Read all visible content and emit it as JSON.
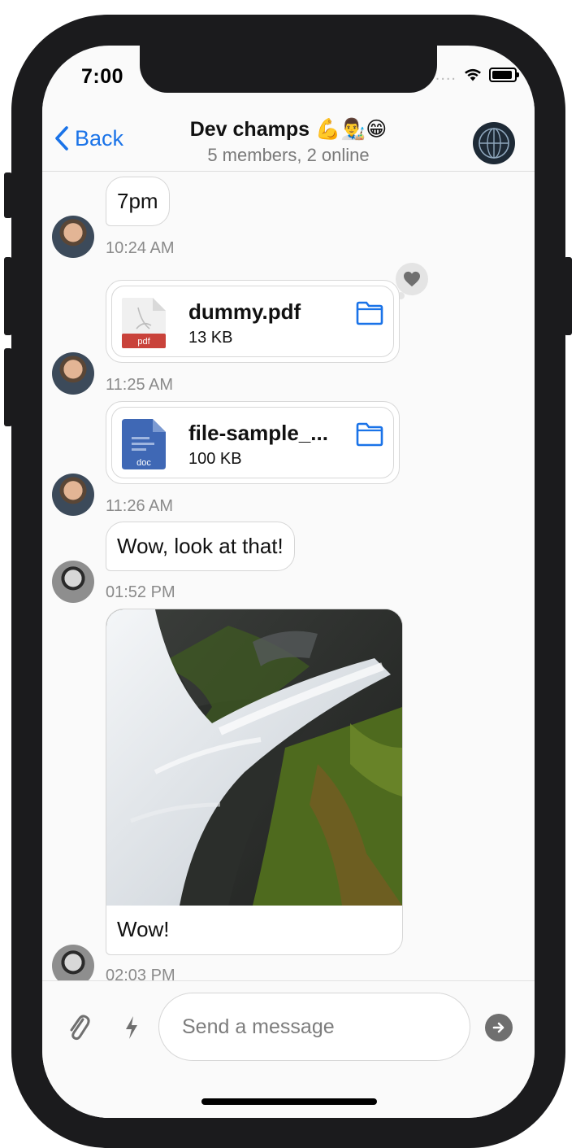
{
  "status": {
    "time": "7:00",
    "signal": "....."
  },
  "nav": {
    "back_label": "Back",
    "title": "Dev champs 💪👨‍🎨😁",
    "subtitle": "5 members, 2 online"
  },
  "messages": [
    {
      "type": "text",
      "text": "7pm",
      "time": "10:24 AM"
    },
    {
      "type": "file",
      "file_name": "dummy.pdf",
      "file_size": "13 KB",
      "file_type": "pdf",
      "time": "11:25 AM",
      "reaction": "heart-icon"
    },
    {
      "type": "file",
      "file_name": "file-sample_...",
      "file_size": "100 KB",
      "file_type": "doc",
      "time": "11:26 AM"
    },
    {
      "type": "text",
      "text": "Wow, look at that!",
      "time": "01:52 PM"
    },
    {
      "type": "image",
      "caption": "Wow!",
      "time": "02:03 PM"
    }
  ],
  "composer": {
    "placeholder": "Send a message"
  },
  "colors": {
    "accent": "#1a73e8",
    "pdf": "#c9423a",
    "doc": "#3f68b5"
  }
}
